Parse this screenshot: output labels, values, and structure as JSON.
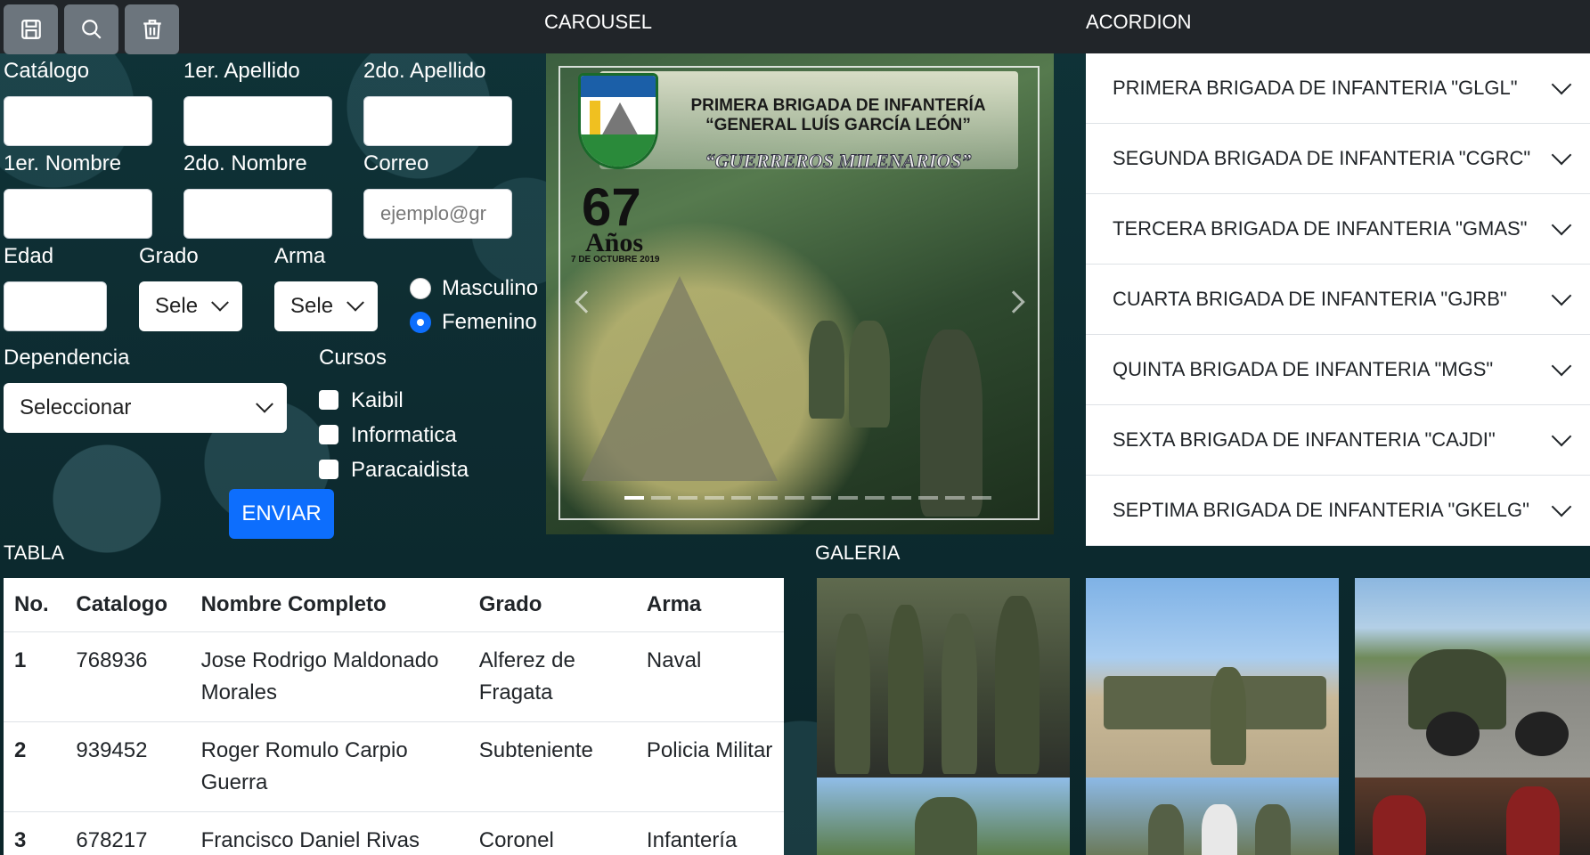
{
  "toolbar": {
    "icons": [
      "save-icon",
      "search-icon",
      "trash-icon"
    ]
  },
  "sections": {
    "carousel": "CAROUSEL",
    "accordion": "ACORDION",
    "table": "TABLA",
    "gallery": "GALERIA"
  },
  "form": {
    "catalogo_label": "Catálogo",
    "apellido1_label": "1er. Apellido",
    "apellido2_label": "2do. Apellido",
    "nombre1_label": "1er. Nombre",
    "nombre2_label": "2do. Nombre",
    "correo_label": "Correo",
    "correo_placeholder": "ejemplo@gr",
    "edad_label": "Edad",
    "grado_label": "Grado",
    "grado_value": "Sele",
    "arma_label": "Arma",
    "arma_value": "Sele",
    "gender_masculino": "Masculino",
    "gender_femenino": "Femenino",
    "gender_selected": "Femenino",
    "dependencia_label": "Dependencia",
    "dependencia_value": "Seleccionar",
    "cursos_label": "Cursos",
    "cursos": [
      "Kaibil",
      "Informatica",
      "Paracaidista"
    ],
    "submit_label": "ENVIAR"
  },
  "carousel": {
    "title_line1": "PRIMERA BRIGADA DE INFANTERÍA",
    "title_line2": "“GENERAL LUÍS GARCÍA LEÓN”",
    "motto": "“GUERREROS MILENARIOS”",
    "anos_number": "67",
    "anos_word": "Años",
    "date": "7 DE OCTUBRE 2019",
    "slide_count": 14,
    "active_slide": 0
  },
  "accordion": {
    "items": [
      "PRIMERA BRIGADA DE INFANTERIA \"GLGL\"",
      "SEGUNDA BRIGADA DE INFANTERIA \"CGRC\"",
      "TERCERA BRIGADA DE INFANTERIA \"GMAS\"",
      "CUARTA BRIGADA DE INFANTERIA \"GJRB\"",
      "QUINTA BRIGADA DE INFANTERIA \"MGS\"",
      "SEXTA BRIGADA DE INFANTERIA \"CAJDI\"",
      "SEPTIMA BRIGADA DE INFANTERIA \"GKELG\""
    ]
  },
  "table": {
    "headers": [
      "No.",
      "Catalogo",
      "Nombre Completo",
      "Grado",
      "Arma"
    ],
    "rows": [
      [
        "1",
        "768936",
        "Jose Rodrigo Maldonado Morales",
        "Alferez de Fragata",
        "Naval"
      ],
      [
        "2",
        "939452",
        "Roger Romulo Carpio Guerra",
        "Subteniente",
        "Policia Militar"
      ],
      [
        "3",
        "678217",
        "Francisco Daniel Rivas",
        "Coronel",
        "Infantería"
      ]
    ]
  },
  "colors": {
    "primary": "#0d6efd",
    "toolbar_button": "#6c757d",
    "dark_bar": "#212529"
  }
}
